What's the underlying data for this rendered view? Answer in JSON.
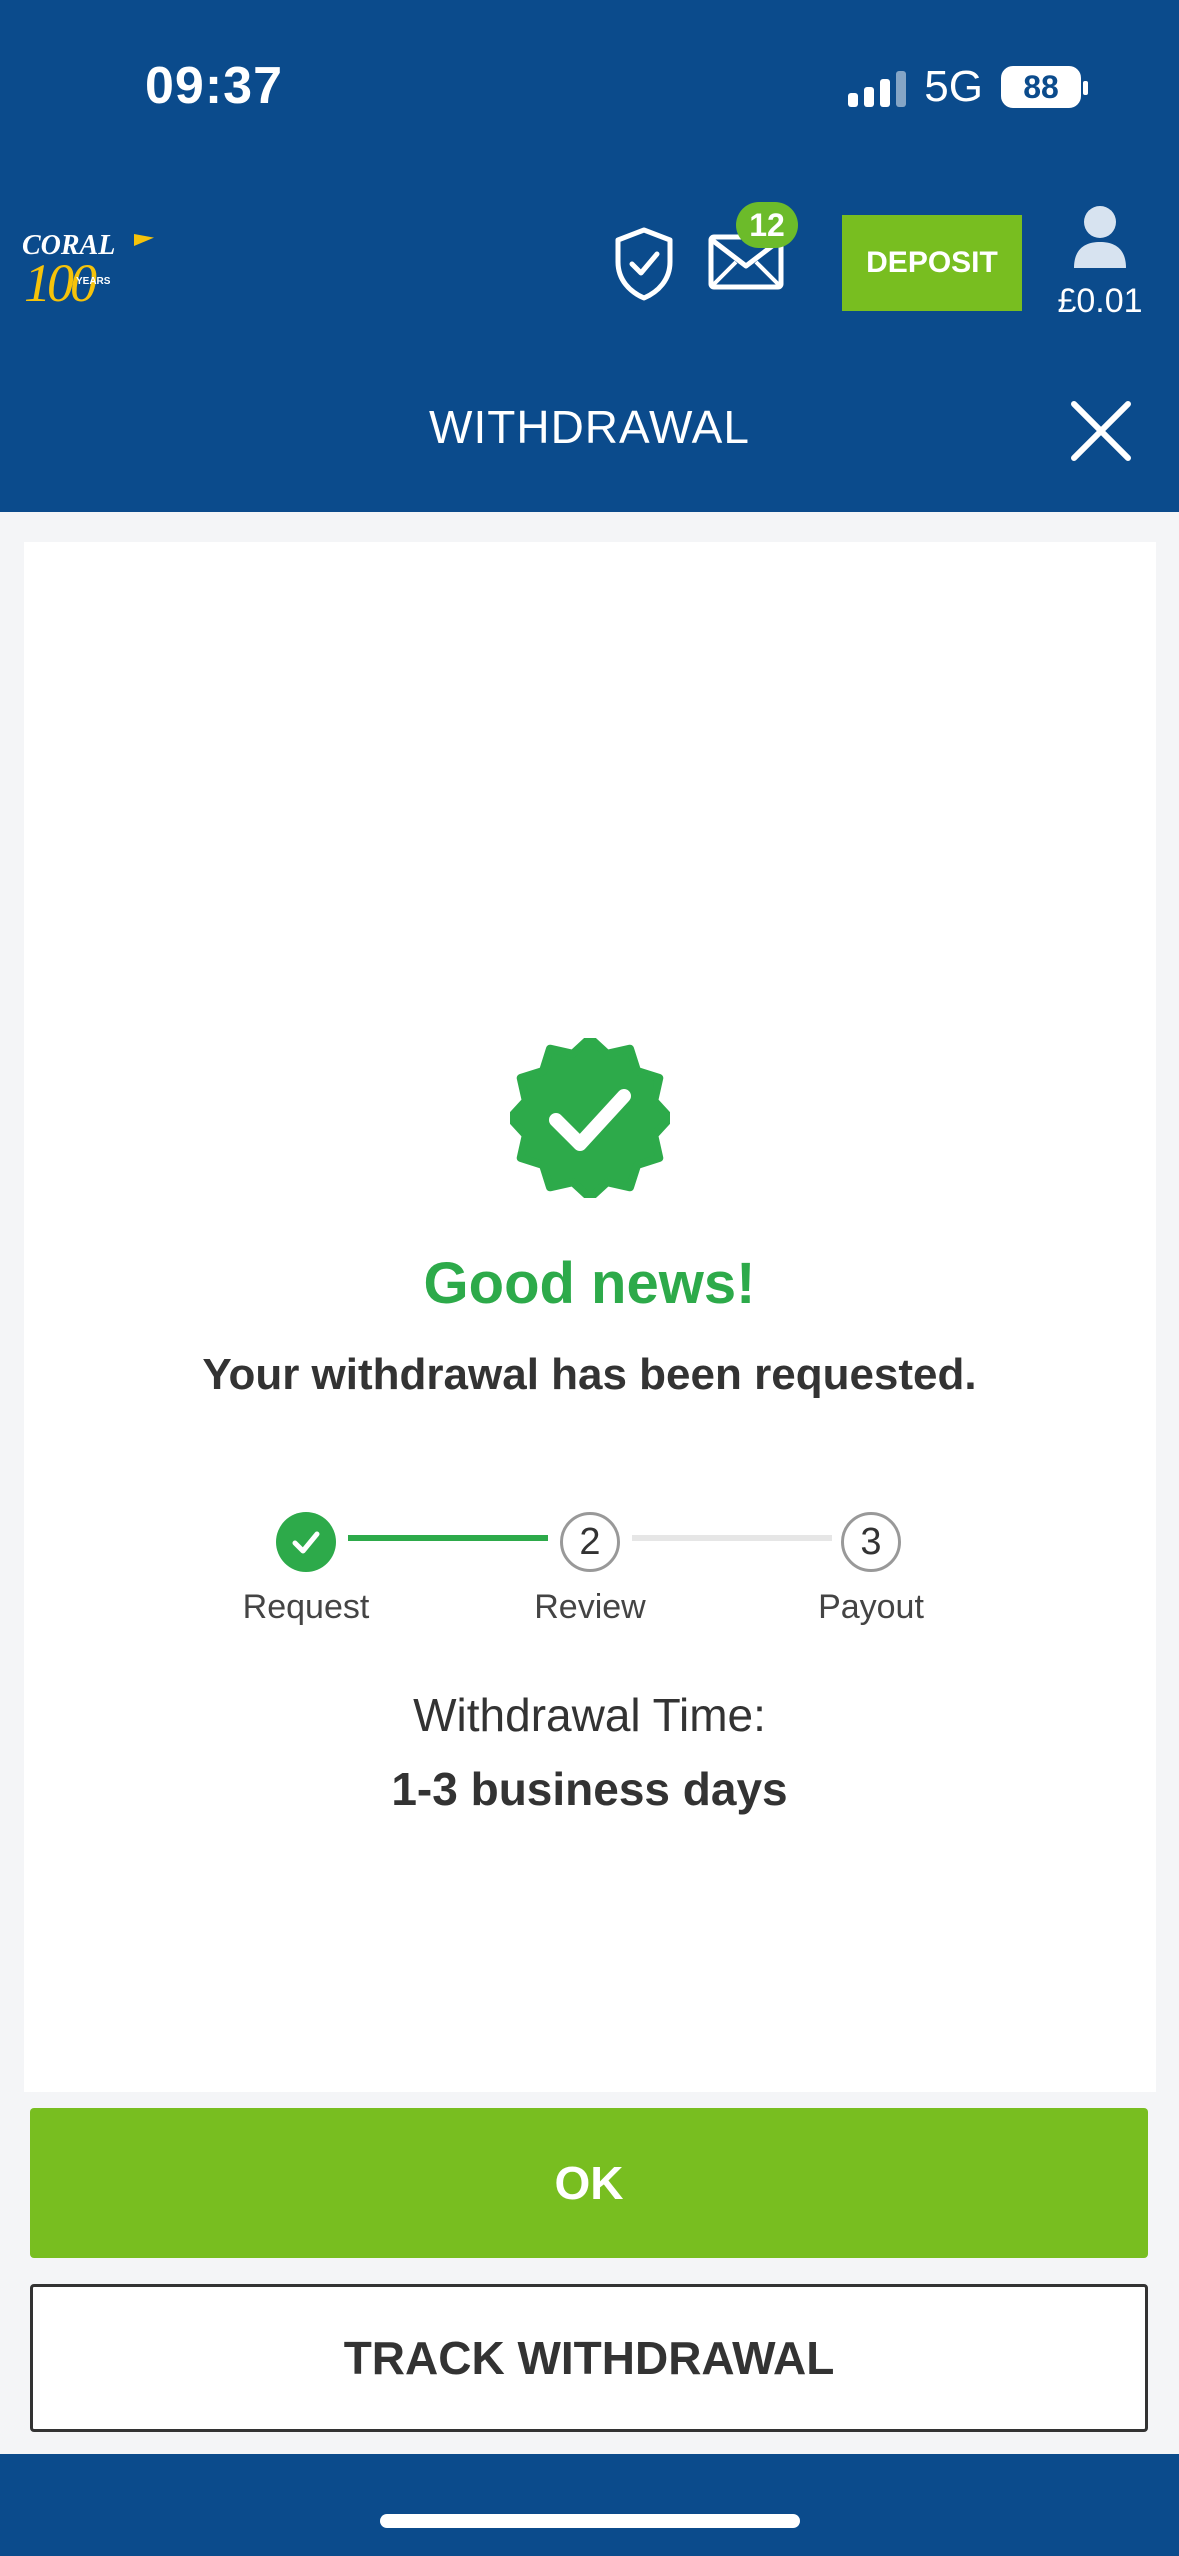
{
  "status_bar": {
    "time": "09:37",
    "network": "5G",
    "battery": "88"
  },
  "header": {
    "logo": {
      "brand": "CORAL",
      "hundred": "100",
      "years": "YEARS"
    },
    "messages_badge": "12",
    "deposit_label": "DEPOSIT",
    "balance": "£0.01",
    "title": "WITHDRAWAL"
  },
  "confirmation": {
    "heading": "Good news!",
    "message": "Your withdrawal has been requested.",
    "steps": [
      {
        "number": "1",
        "label": "Request"
      },
      {
        "number": "2",
        "label": "Review"
      },
      {
        "number": "3",
        "label": "Payout"
      }
    ],
    "time_label": "Withdrawal Time:",
    "time_value": "1-3 business days"
  },
  "actions": {
    "ok_label": "OK",
    "track_label": "TRACK WITHDRAWAL"
  },
  "colors": {
    "brand_blue": "#0b4b8c",
    "accent_green": "#78be20",
    "success_green": "#2daa4a"
  },
  "icons": {
    "shield": "shield-check-icon",
    "mail": "mail-icon",
    "avatar": "user-icon",
    "close": "close-icon",
    "verified": "verified-badge-icon"
  }
}
